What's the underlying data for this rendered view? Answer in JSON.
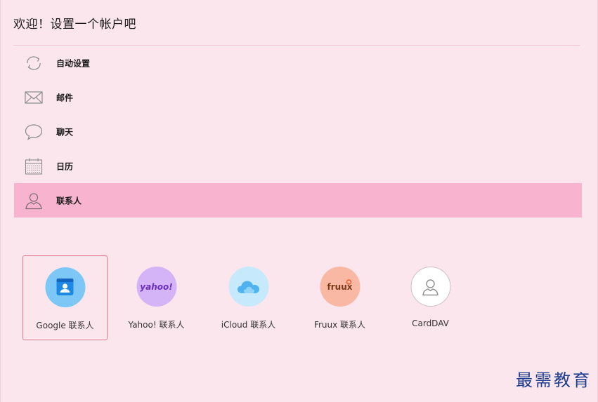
{
  "header": {
    "title": "欢迎！设置一个帐户吧"
  },
  "menu": {
    "items": [
      {
        "label": "自动设置",
        "icon": "sync-icon"
      },
      {
        "label": "邮件",
        "icon": "mail-icon"
      },
      {
        "label": "聊天",
        "icon": "chat-bubble-icon"
      },
      {
        "label": "日历",
        "icon": "calendar-icon"
      },
      {
        "label": "联系人",
        "icon": "person-icon",
        "selected": true
      }
    ]
  },
  "providers": {
    "items": [
      {
        "label": "Google 联系人",
        "icon": "google-contacts-icon",
        "color": "#4aa9e8",
        "bg": "#7cc7f5",
        "selected": true
      },
      {
        "label": "Yahoo! 联系人",
        "icon": "yahoo-icon",
        "logo_text": "yahoo!",
        "color": "#6b2fbd",
        "bg": "#d4b3f7"
      },
      {
        "label": "iCloud 联系人",
        "icon": "icloud-icon",
        "color": "#4fb3f0",
        "bg": "#c6eafb"
      },
      {
        "label": "Fruux 联系人",
        "icon": "fruux-icon",
        "logo_text": "fruux",
        "color": "#7a3b1c",
        "bg": "#f9b8a3"
      },
      {
        "label": "CardDAV",
        "icon": "carddav-person-icon",
        "color": "#999999",
        "bg": "#ffffff"
      }
    ]
  },
  "watermark": {
    "text": "最需教育"
  },
  "colors": {
    "background": "#fbe6ed",
    "selected_row": "#f8b4cf",
    "selected_border": "#e0798f",
    "watermark": "#1d3d8f"
  }
}
